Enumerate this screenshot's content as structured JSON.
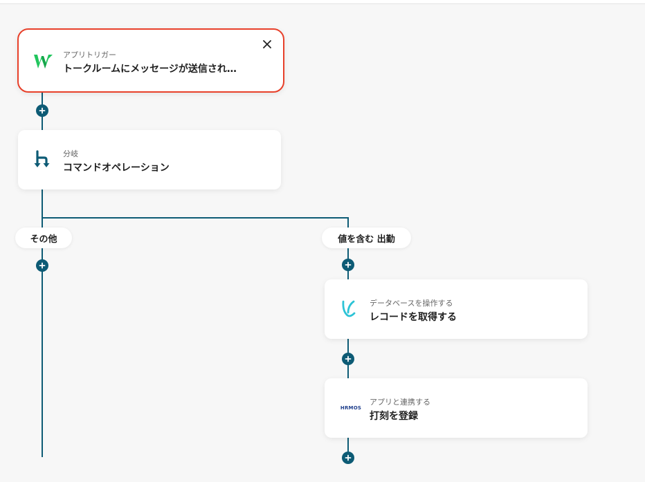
{
  "trigger": {
    "category": "アプリトリガー",
    "title": "トークルームにメッセージが送信され…",
    "icon": "wowtalk-w-logo-icon",
    "close_icon": "close-icon"
  },
  "branch": {
    "category": "分岐",
    "title": "コマンドオペレーション",
    "icon": "branch-icon"
  },
  "branches": {
    "left_label": "その他",
    "right_label": "値を含む 出勤"
  },
  "db_step": {
    "category": "データベースを操作する",
    "title": "レコードを取得する",
    "icon": "yoom-database-icon"
  },
  "app_step": {
    "category": "アプリと連携する",
    "title": "打刻を登録",
    "icon": "hrmos-logo-icon",
    "logo_text": "HRMOS"
  },
  "add_step_icon": "plus-icon",
  "colors": {
    "connector": "#0d5b75",
    "selected_border": "#e8402a",
    "background": "#f7f7f7",
    "card": "#ffffff"
  }
}
